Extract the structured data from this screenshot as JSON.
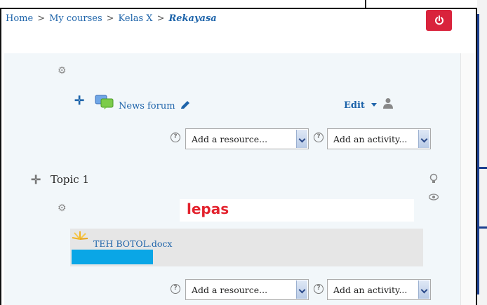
{
  "breadcrumb": {
    "home": "Home",
    "my_courses": "My courses",
    "course": "Kelas X",
    "current": "Rekayasa",
    "separator": ">"
  },
  "forum": {
    "link": "News forum",
    "edit_menu": "Edit"
  },
  "resource_select": {
    "selected": "Add a resource..."
  },
  "activity_select": {
    "selected": "Add an activity..."
  },
  "topic": {
    "title": "Topic 1",
    "annotation": "lepas"
  },
  "upload": {
    "filename": "TEH BOTOL.docx",
    "progress_percent": 23
  },
  "colors": {
    "link": "#1e64aa",
    "logout": "#d9233c",
    "annotation": "#e3222d",
    "progress": "#0aa6e6",
    "section_bg": "#f2f7fa"
  },
  "icons": [
    "power-icon",
    "gear-icon",
    "move-icon",
    "forum-icon",
    "pencil-icon",
    "caret-down-icon",
    "user-icon",
    "help-icon",
    "lightbulb-icon",
    "eye-icon",
    "file-upload-icon"
  ]
}
